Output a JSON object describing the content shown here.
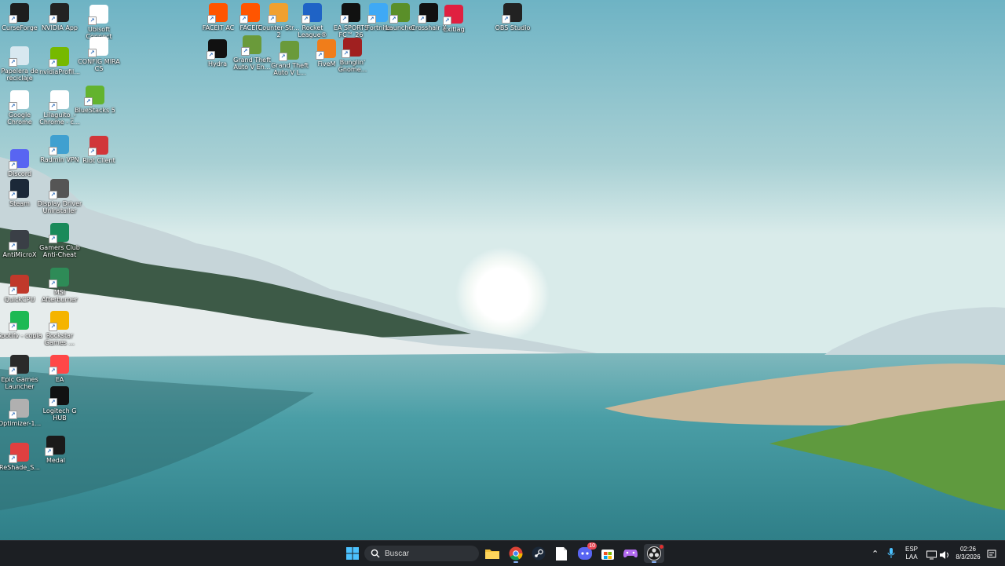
{
  "desktop": {
    "icons_col1": [
      {
        "label": "CurseForge",
        "icon": "curseforge-icon",
        "color": "#1d1d1d"
      },
      {
        "label": "Papelera de reciclaje",
        "icon": "recycle-bin-icon",
        "color": "#d8e8f0"
      },
      {
        "label": "Google Chrome",
        "icon": "chrome-icon",
        "color": "#ffffff"
      },
      {
        "label": "Discord",
        "icon": "discord-icon",
        "color": "#5865f2"
      },
      {
        "label": "Steam",
        "icon": "steam-icon",
        "color": "#1b2838"
      },
      {
        "label": "AntiMicroX",
        "icon": "gamepad-icon",
        "color": "#3a3f46"
      },
      {
        "label": "QuickCPU",
        "icon": "cpu-icon",
        "color": "#c0392b"
      },
      {
        "label": "Spotify - copia",
        "icon": "spotify-icon",
        "color": "#1db954"
      },
      {
        "label": "Epic Games Launcher",
        "icon": "epic-games-icon",
        "color": "#2a2a2a"
      },
      {
        "label": "Optimizer-1...",
        "icon": "checkmark-icon",
        "color": "#b0b0b0"
      },
      {
        "label": "ReShade_S...",
        "icon": "reshade-icon",
        "color": "#e04040"
      }
    ],
    "icons_col2": [
      {
        "label": "NVIDIA App",
        "icon": "nvidia-icon",
        "color": "#222222"
      },
      {
        "label": "nvidiaProfil...",
        "icon": "nvidia-profile-icon",
        "color": "#76b900"
      },
      {
        "label": "Lilaguito_- Chrome - c...",
        "icon": "chrome-profile-icon",
        "color": "#ffffff"
      },
      {
        "label": "Radmin VPN",
        "icon": "radmin-vpn-icon",
        "color": "#40a0d0"
      },
      {
        "label": "Display Driver Uninstaller",
        "icon": "ddu-icon",
        "color": "#555555"
      },
      {
        "label": "Gamers Club Anti-Cheat",
        "icon": "gamers-club-icon",
        "color": "#1a8a5a"
      },
      {
        "label": "MSI Afterburner",
        "icon": "afterburner-icon",
        "color": "#2e8b57"
      },
      {
        "label": "Rockstar Games ...",
        "icon": "rockstar-icon",
        "color": "#f5b400"
      },
      {
        "label": "EA",
        "icon": "ea-icon",
        "color": "#ff4747"
      },
      {
        "label": "Logitech G HUB",
        "icon": "logitech-icon",
        "color": "#111111"
      },
      {
        "label": "Medal",
        "icon": "medal-icon",
        "color": "#1a1a1a"
      }
    ],
    "icons_col3": [
      {
        "label": "Ubisoft Connect",
        "icon": "ubisoft-icon",
        "color": "#ffffff"
      },
      {
        "label": "CONFIG MIRA CS",
        "icon": "file-icon",
        "color": "#ffffff"
      },
      {
        "label": "BlueStacks 5",
        "icon": "bluestacks-icon",
        "color": "#63b32e"
      },
      {
        "label": "Riot Client",
        "icon": "riot-icon",
        "color": "#d13639"
      }
    ],
    "icons_top_row1": [
      {
        "label": "FACEIT AC",
        "icon": "faceit-ac-icon",
        "color": "#ff5500"
      },
      {
        "label": "FACEIT",
        "icon": "faceit-icon",
        "color": "#ff5500"
      },
      {
        "label": "Counter-Str... 2",
        "icon": "cs2-icon",
        "color": "#f0a030"
      },
      {
        "label": "Rocket League®",
        "icon": "rocket-league-icon",
        "color": "#1f63c6"
      },
      {
        "label": "EA SPORTS FC™ 26",
        "icon": "ea-fc-icon",
        "color": "#111111"
      },
      {
        "label": "Fortnite",
        "icon": "fortnite-icon",
        "color": "#3fa9f5"
      },
      {
        "label": "Launcher",
        "icon": "minecraft-icon",
        "color": "#5a8f29"
      },
      {
        "label": "Crosshair X",
        "icon": "crosshair-icon",
        "color": "#111111"
      },
      {
        "label": "Exitlag",
        "icon": "exitlag-icon",
        "color": "#e02040"
      }
    ],
    "icons_top_row2": [
      {
        "label": "Hydra",
        "icon": "hydra-icon",
        "color": "#111111"
      },
      {
        "label": "Grand Theft Auto V En...",
        "icon": "gta-v-enhanced-icon",
        "color": "#6a9a3a"
      },
      {
        "label": "Grand Theft Auto V L...",
        "icon": "gta-v-legacy-icon",
        "color": "#6a9a3a"
      },
      {
        "label": "FiveM",
        "icon": "fivem-icon",
        "color": "#f07d1a"
      },
      {
        "label": "Bunglin' Gnome...",
        "icon": "gnome-game-icon",
        "color": "#a02020"
      }
    ],
    "obs": {
      "label": "OBS Studio",
      "icon": "obs-icon",
      "color": "#222222"
    }
  },
  "taskbar": {
    "search_placeholder": "Buscar",
    "apps": [
      "windows-start-icon",
      "file-explorer-icon",
      "chrome-icon",
      "steam-icon",
      "notepad-icon",
      "discord-icon",
      "microsoft-store-icon",
      "game-controller-icon",
      "obs-icon"
    ],
    "discord_badge": "10",
    "tray": {
      "language": "ESP",
      "layout": "LAA",
      "time": "02:26",
      "date": "8/3/2026"
    }
  },
  "colors": {
    "sky_top": "#6fb5c7",
    "sky_horizon": "#d8eaea",
    "water": "#3f9aa3",
    "taskbar": "#1c1f23"
  }
}
